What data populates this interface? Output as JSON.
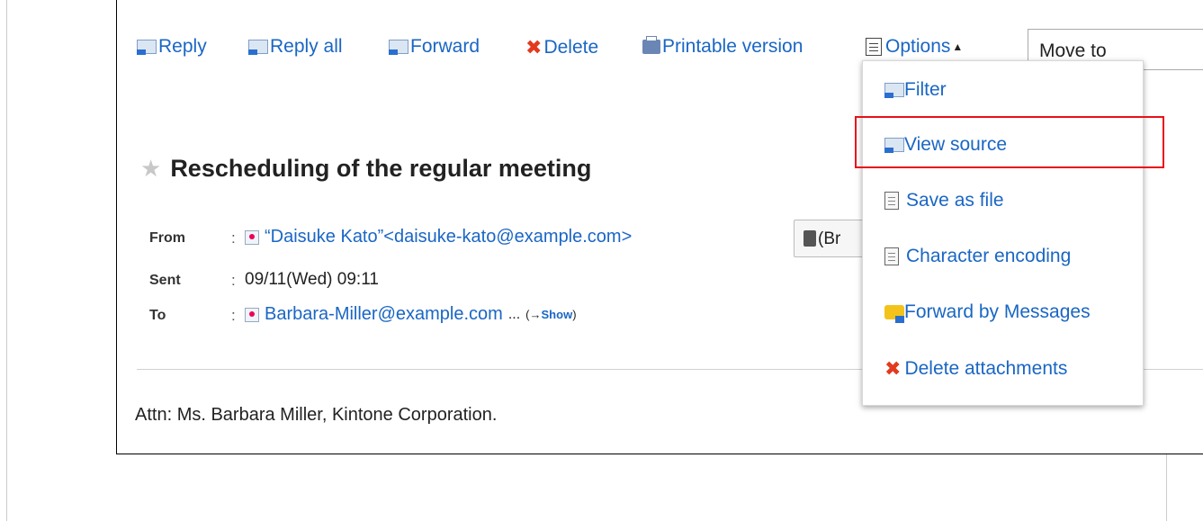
{
  "toolbar": {
    "reply": "Reply",
    "reply_all": "Reply all",
    "forward": "Forward",
    "delete": "Delete",
    "printable": "Printable version",
    "options": "Options",
    "move_to": "Move to"
  },
  "message": {
    "subject": "Rescheduling of the regular meeting",
    "from_label": "From",
    "from_value": "“Daisuke Kato”<daisuke-kato@example.com>",
    "address_button": "(Br",
    "sent_label": "Sent",
    "sent_value": "09/11(Wed) 09:11",
    "to_label": "To",
    "to_value": "Barbara-Miller@example.com",
    "to_more": "...",
    "show_prefix": "(→",
    "show_link": "Show",
    "show_suffix": ")",
    "colon": ":",
    "body": "Attn: Ms. Barbara Miller, Kintone Corporation."
  },
  "options_menu": [
    {
      "label": "Filter",
      "icon": "filter-icon"
    },
    {
      "label": "View source",
      "icon": "envelope-doc-icon",
      "highlighted": true
    },
    {
      "label": "Save as file",
      "icon": "document-icon"
    },
    {
      "label": "Character encoding",
      "icon": "document-icon"
    },
    {
      "label": "Forward by Messages",
      "icon": "message-bubble-icon"
    },
    {
      "label": "Delete attachments",
      "icon": "delete-x-icon"
    }
  ],
  "colors": {
    "link": "#1a66c4",
    "highlight": "#e8101a",
    "delete": "#e23a1e"
  }
}
